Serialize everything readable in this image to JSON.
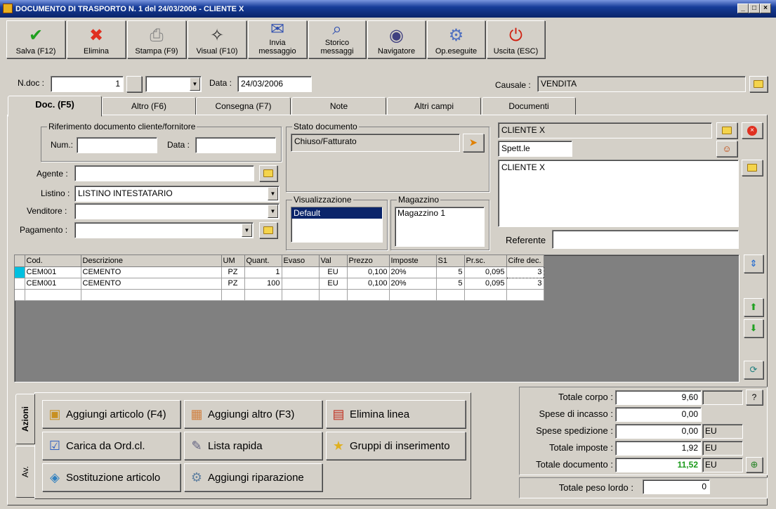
{
  "window": {
    "title": "DOCUMENTO DI TRASPORTO N. 1  del 24/03/2006 - CLIENTE X"
  },
  "toolbar": [
    {
      "label": "Salva (F12)",
      "icon": "save-icon",
      "color": "#20a020"
    },
    {
      "label": "Elimina",
      "icon": "delete-icon",
      "color": "#e03020"
    },
    {
      "label": "Stampa (F9)",
      "icon": "printer-icon",
      "color": "#808080"
    },
    {
      "label": "Visual (F10)",
      "icon": "magic-wand-icon",
      "color": "#303030"
    },
    {
      "label": "Invia\nmessaggio",
      "icon": "send-message-icon",
      "color": "#3050b0"
    },
    {
      "label": "Storico\nmessaggi",
      "icon": "message-history-icon",
      "color": "#3050b0"
    },
    {
      "label": "Navigatore",
      "icon": "compass-icon",
      "color": "#404080"
    },
    {
      "label": "Op.eseguite",
      "icon": "gears-search-icon",
      "color": "#5070c0"
    },
    {
      "label": "Uscita (ESC)",
      "icon": "exit-power-icon",
      "color": "#d02010"
    }
  ],
  "header": {
    "ndoc_label": "N.doc :",
    "ndoc_value": "1",
    "data_label": "Data :",
    "data_value": "24/03/2006",
    "causale_label": "Causale :",
    "causale_value": "VENDITA"
  },
  "tabs": [
    "Doc. (F5)",
    "Altro (F6)",
    "Consegna (F7)",
    "Note",
    "Altri campi",
    "Documenti"
  ],
  "riferimento": {
    "legend": "Riferimento documento cliente/fornitore",
    "num_label": "Num.:",
    "data_label": "Data :"
  },
  "fields": {
    "agente_label": "Agente :",
    "listino_label": "Listino :",
    "listino_value": "LISTINO INTESTATARIO",
    "venditore_label": "Venditore :",
    "pagamento_label": "Pagamento :"
  },
  "stato": {
    "legend": "Stato documento",
    "value": "Chiuso/Fatturato"
  },
  "visualizzazione": {
    "legend": "Visualizzazione",
    "items": [
      "Default"
    ]
  },
  "magazzino": {
    "legend": "Magazzino",
    "items": [
      "Magazzino 1"
    ]
  },
  "cliente": {
    "name": "CLIENTE X",
    "title": "Spett.le",
    "address": "CLIENTE X",
    "referente_label": "Referente"
  },
  "grid": {
    "columns": [
      "Cod.",
      "Descrizione",
      "UM",
      "Quant.",
      "Evaso",
      "Val",
      "Prezzo",
      "Imposte",
      "S1",
      "Pr.sc.",
      "Cifre dec."
    ],
    "rows": [
      [
        "CEM001",
        "CEMENTO",
        "PZ",
        "1",
        "",
        "EU",
        "0,100",
        "20%",
        "5",
        "0,095",
        "3"
      ],
      [
        "CEM001",
        "CEMENTO",
        "PZ",
        "100",
        "",
        "EU",
        "0,100",
        "20%",
        "5",
        "0,095",
        "3"
      ]
    ]
  },
  "azioni": {
    "tab_label": "Azioni",
    "tab2_label": "Av.",
    "buttons": [
      {
        "label": "Aggiungi articolo (F4)",
        "icon": "add-box-icon"
      },
      {
        "label": "Aggiungi altro (F3)",
        "icon": "add-table-icon"
      },
      {
        "label": "Elimina linea",
        "icon": "delete-line-icon"
      },
      {
        "label": "Carica da Ord.cl.",
        "icon": "load-order-icon"
      },
      {
        "label": "Lista rapida",
        "icon": "quick-list-icon"
      },
      {
        "label": "Gruppi di inserimento",
        "icon": "star-group-icon"
      },
      {
        "label": "Sostituzione articolo",
        "icon": "replace-item-icon"
      },
      {
        "label": "Aggiungi riparazione",
        "icon": "repair-gear-icon"
      }
    ]
  },
  "totali": {
    "corpo_label": "Totale corpo :",
    "corpo_value": "9,60",
    "incasso_label": "Spese di incasso :",
    "incasso_value": "0,00",
    "spedizione_label": "Spese spedizione :",
    "spedizione_value": "0,00",
    "spedizione_cur": "EU",
    "imposte_label": "Totale imposte :",
    "imposte_value": "1,92",
    "imposte_cur": "EU",
    "documento_label": "Totale documento :",
    "documento_value": "11,52",
    "documento_cur": "EU",
    "help_label": "?",
    "peso_label": "Totale peso lordo :",
    "peso_value": "0"
  },
  "colors": {
    "total_green": "#1a9a1a",
    "selection": "#0a246a",
    "grid_bg": "#808080"
  }
}
